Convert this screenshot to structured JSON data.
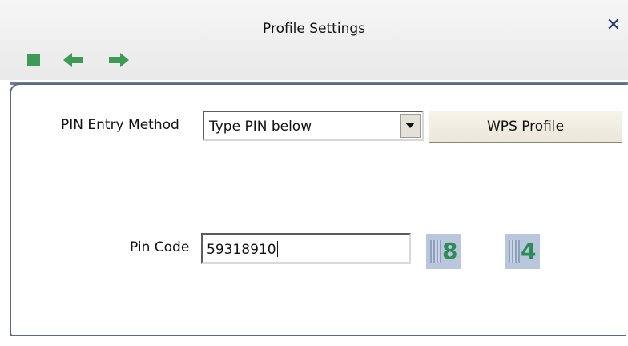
{
  "window": {
    "title": "Profile Settings",
    "close_glyph": "✕"
  },
  "toolbar": {
    "buttons": [
      {
        "name": "stop-icon",
        "color": "#3f9a57"
      },
      {
        "name": "back-arrow-icon",
        "color": "#3f9a57"
      },
      {
        "name": "forward-arrow-icon",
        "color": "#3f9a57"
      }
    ]
  },
  "form": {
    "pin_entry_method_label": "PIN Entry Method",
    "pin_entry_method_value": "Type PIN below",
    "wps_profile_button": "WPS Profile",
    "pin_code_label": "Pin Code",
    "pin_code_value": "59318910",
    "digit_buttons": [
      "8",
      "4"
    ]
  },
  "colors": {
    "accent_green": "#3f9a57",
    "panel_border": "#5a6a84",
    "digit_button_bg": "#b9c6dc"
  }
}
